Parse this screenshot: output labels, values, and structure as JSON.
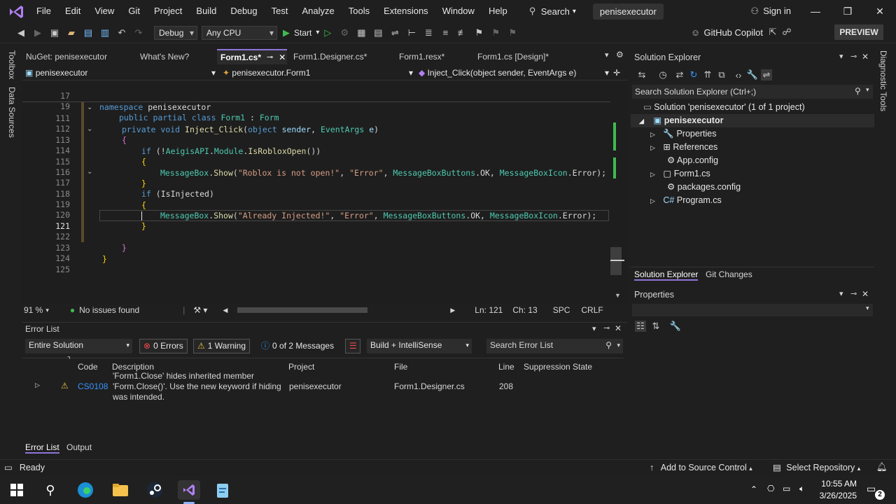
{
  "menu": {
    "items": [
      "File",
      "Edit",
      "View",
      "Git",
      "Project",
      "Build",
      "Debug",
      "Test",
      "Analyze",
      "Tools",
      "Extensions",
      "Window",
      "Help"
    ],
    "search_label": "Search",
    "solution_name": "penisexecutor",
    "signin": "Sign in"
  },
  "toolbar": {
    "config": "Debug",
    "platform": "Any CPU",
    "start": "Start",
    "copilot": "GitHub Copilot",
    "preview": "PREVIEW"
  },
  "left_strip": {
    "toolbox": "Toolbox",
    "data_sources": "Data Sources"
  },
  "right_strip": {
    "diagnostic_tools": "Diagnostic Tools"
  },
  "tabs": [
    {
      "label": "NuGet: penisexecutor"
    },
    {
      "label": "What's New?"
    },
    {
      "label": "Form1.cs*",
      "active": true
    },
    {
      "label": "Form1.Designer.cs*"
    },
    {
      "label": "Form1.resx*"
    },
    {
      "label": "Form1.cs [Design]*"
    }
  ],
  "nav": {
    "project": "penisexecutor",
    "class": "penisexecutor.Form1",
    "member": "Inject_Click(object sender, EventArgs e)"
  },
  "sticky": [
    {
      "ln": "17",
      "text": "namespace penisexecutor"
    },
    {
      "ln": "19",
      "text": "public partial class Form1 : Form"
    }
  ],
  "code_lines": [
    {
      "ln": "111",
      "text": "private void Inject_Click(object sender, EventArgs e)"
    },
    {
      "ln": "112",
      "text": "{"
    },
    {
      "ln": "113",
      "text": "if (!AeigisAPI.Module.IsRobloxOpen())"
    },
    {
      "ln": "114",
      "text": "{"
    },
    {
      "ln": "115",
      "text": "MessageBox.Show(\"Roblox is not open!\", \"Error\", MessageBoxButtons.OK, MessageBoxIcon.Error);"
    },
    {
      "ln": "116",
      "text": "}"
    },
    {
      "ln": "117",
      "text": "if (IsInjected)"
    },
    {
      "ln": "118",
      "text": "{"
    },
    {
      "ln": "119",
      "text": "MessageBox.Show(\"Already Injected!\", \"Error\", MessageBoxButtons.OK, MessageBoxIcon.Error);"
    },
    {
      "ln": "120",
      "text": "}"
    },
    {
      "ln": "121",
      "text": ""
    },
    {
      "ln": "122",
      "text": "}"
    },
    {
      "ln": "123",
      "text": "}"
    },
    {
      "ln": "124",
      "text": ""
    },
    {
      "ln": "125",
      "text": ""
    }
  ],
  "editor_status": {
    "zoom": "91 %",
    "issues": "No issues found",
    "line": "Ln: 121",
    "col": "Ch: 13",
    "spc": "SPC",
    "eol": "CRLF"
  },
  "error_list": {
    "title": "Error List",
    "scope": "Entire Solution",
    "errors": "0 Errors",
    "warnings": "1 Warning",
    "messages": "0 of 2 Messages",
    "build_filter": "Build + IntelliSense",
    "search_placeholder": "Search Error List",
    "columns": [
      "Code",
      "Description",
      "Project",
      "File",
      "Line",
      "Suppression State"
    ],
    "rows": [
      {
        "code": "CS0108",
        "description": [
          "'Form1.Close' hides inherited member",
          "'Form.Close()'. Use the new keyword if hiding",
          "was intended."
        ],
        "project": "penisexecutor",
        "file": "Form1.Designer.cs",
        "line": "208",
        "suppression": ""
      }
    ],
    "tabs": [
      "Error List",
      "Output"
    ]
  },
  "solution_explorer": {
    "title": "Solution Explorer",
    "search_placeholder": "Search Solution Explorer (Ctrl+;)",
    "tree": [
      {
        "label": "Solution 'penisexecutor' (1 of 1 project)",
        "icon": "solution-icon"
      },
      {
        "label": "penisexecutor",
        "icon": "csharp-project-icon"
      },
      {
        "label": "Properties",
        "icon": "wrench-icon"
      },
      {
        "label": "References",
        "icon": "references-icon"
      },
      {
        "label": "App.config",
        "icon": "config-file-icon"
      },
      {
        "label": "Form1.cs",
        "icon": "form-icon"
      },
      {
        "label": "packages.config",
        "icon": "config-file-icon"
      },
      {
        "label": "Program.cs",
        "icon": "csharp-file-icon"
      }
    ],
    "bottom_tabs": [
      "Solution Explorer",
      "Git Changes"
    ]
  },
  "properties": {
    "title": "Properties"
  },
  "status_bar": {
    "ready": "Ready",
    "source_control": "Add to Source Control",
    "repo": "Select Repository"
  },
  "taskbar": {
    "time": "10:55 AM",
    "date": "3/26/2025",
    "notifications": "2"
  }
}
